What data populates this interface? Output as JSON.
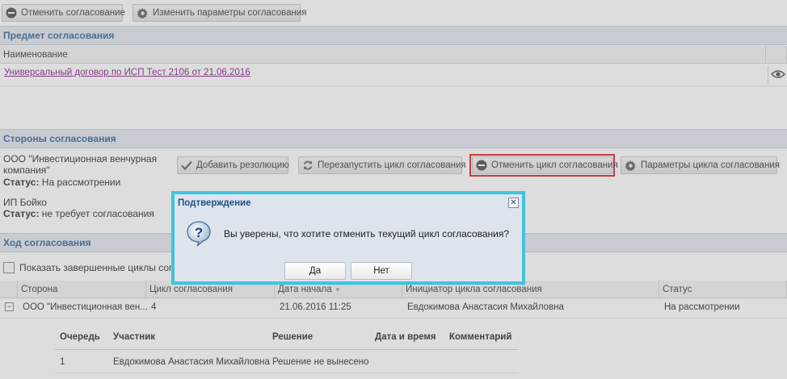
{
  "toolbar": {
    "cancel_approval": "Отменить согласование",
    "change_params": "Изменить параметры согласования"
  },
  "subject": {
    "section_title": "Предмет согласования",
    "column_name": "Наименование",
    "document_link": "Универсальный договор по ИСП Тест 2106 от 21.06.2016"
  },
  "parties": {
    "section_title": "Стороны согласования",
    "party1": {
      "name_line1": "ООО \"Инвестиционная венчурная",
      "name_line2": "компания\"",
      "status_label": "Статус:",
      "status_value": "На рассмотрении"
    },
    "party2": {
      "name": "ИП Бойко",
      "status_label": "Статус:",
      "status_value": "не требует согласования"
    },
    "buttons": {
      "add_resolution": "Добавить резолюцию",
      "restart_cycle": "Перезапустить цикл согласования",
      "cancel_cycle": "Отменить цикл согласования",
      "cycle_params": "Параметры цикла согласования"
    }
  },
  "progress": {
    "section_title": "Ход согласования",
    "show_finished": "Показать завершенные циклы согл",
    "columns": {
      "party": "Сторона",
      "cycle": "Цикл согласования",
      "start_date": "Дата начала",
      "initiator": "Инициатор цикла согласования",
      "status": "Статус"
    },
    "row": {
      "expander": "−",
      "party": "ООО \"Инвестиционная вен...",
      "cycle": "4",
      "start_date": "21.06.2016 11:25",
      "initiator": "Евдокимова Анастасия Михайловна",
      "status": "На рассмотрении"
    },
    "sub_columns": {
      "queue": "Очередь",
      "participant": "Участник",
      "decision": "Решение",
      "datetime": "Дата и время",
      "comment": "Комментарий"
    },
    "sub_row": {
      "queue": "1",
      "participant": "Евдокимова Анастасия Михайловна",
      "decision": "Решение не вынесено"
    }
  },
  "dialog": {
    "title": "Подтверждение",
    "close": "✕",
    "message": "Вы уверены, что хотите отменить текущий цикл согласования?",
    "yes": "Да",
    "no": "Нет"
  },
  "colors": {
    "section_bg": "#e3e9f1",
    "section_text": "#3d6a9a",
    "link": "#8e2a8e",
    "highlight": "#e8262b",
    "dialog_border": "#3fc4df"
  }
}
